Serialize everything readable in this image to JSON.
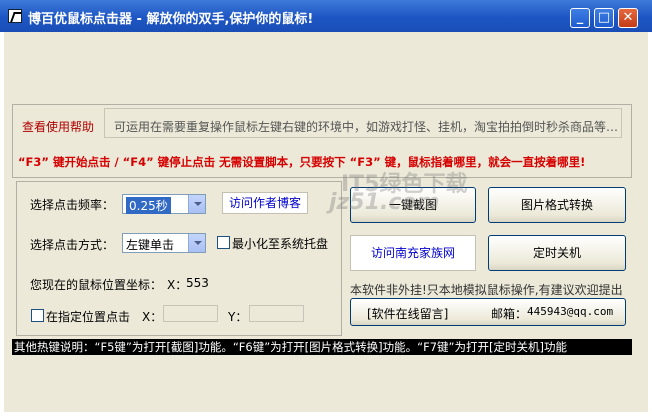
{
  "window": {
    "title": "博百优鼠标点击器 - 解放你的双手,保护你的鼠标!",
    "minimize_glyph": "_",
    "maximize_glyph": "□",
    "close_glyph": "✕"
  },
  "help": {
    "link": "查看使用帮助",
    "description": "可运用在需要重复操作鼠标左键右键的环境中，如游戏打怪、挂机，淘宝拍拍倒时秒杀商品等…"
  },
  "hotkey_line": "“F3” 键开始点击 / “F4” 键停止点击   无需设置脚本，只要按下 “F3” 键，鼠标指着哪里，就会一直按着哪里!",
  "settings": {
    "freq_label": "选择点击频率：",
    "freq_value": "0.25秒",
    "author_blog": "访问作者博客",
    "mode_label": "选择点击方式：",
    "mode_value": "左键单击",
    "minimize_tray": "最小化至系统托盘",
    "position_label": "您现在的鼠标位置坐标：",
    "x_label": "X：",
    "x_value": "553",
    "fixed_pos": "在指定位置点击",
    "x_field_label": "X：",
    "y_field_label": "Y："
  },
  "buttons": {
    "screenshot": "一键截图",
    "image_convert": "图片格式转换",
    "visit_site": "访问南充家族网",
    "shutdown": "定时关机",
    "feedback": "[软件在线留言]",
    "email_label": "邮箱：",
    "email": "445943@qq.com"
  },
  "notice": "本软件非外挂!只本地模拟鼠标操作,有建议欢迎提出",
  "statusbar": "其他热键说明：“F5键”为打开[截图]功能。“F6键”为打开[图片格式转换]功能。“F7键”为打开[定时关机]功能",
  "watermark": "jz51.com",
  "watermark_cn": "IT5绿色下载",
  "colors": {
    "titlebar": "#1d56c4",
    "accent_red": "#d60000",
    "link_blue": "#0000cc"
  }
}
